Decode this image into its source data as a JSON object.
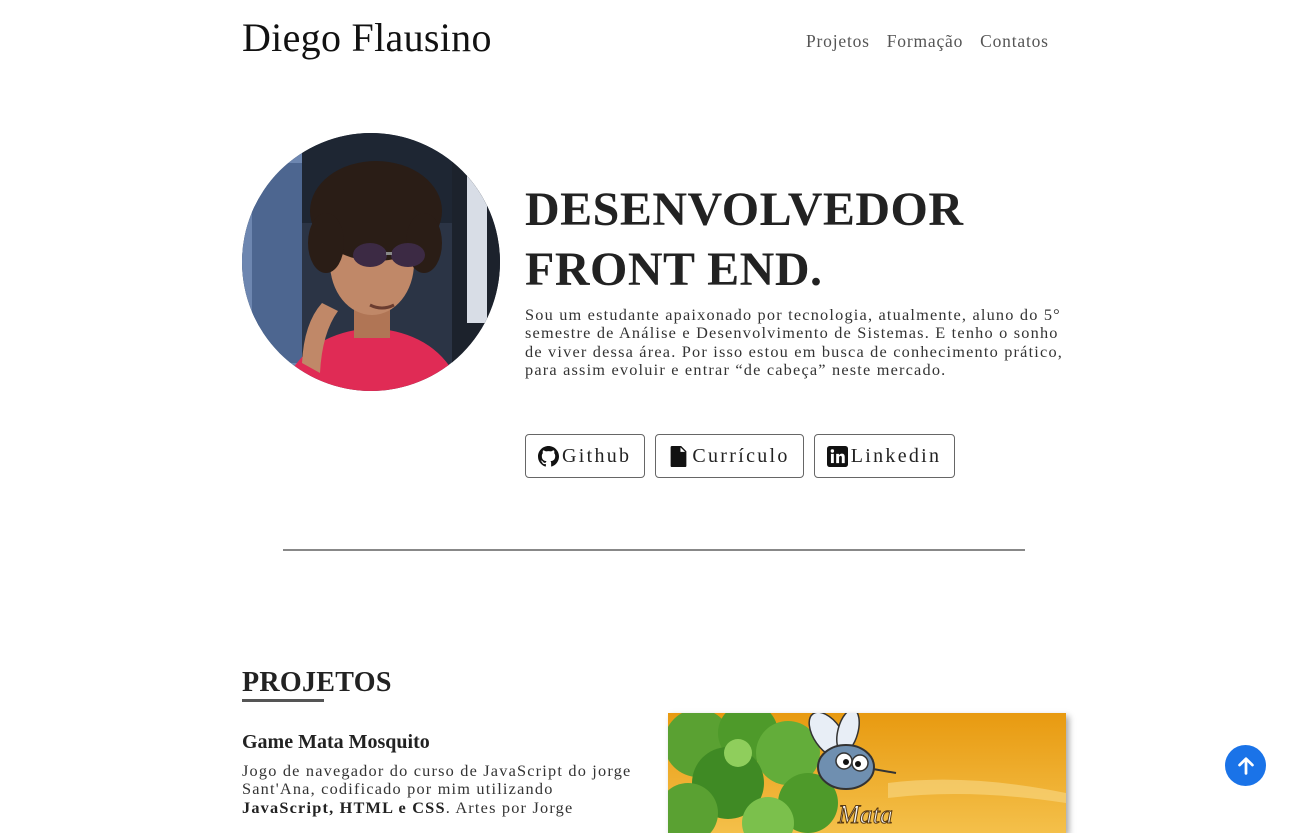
{
  "header": {
    "logo": "Diego Flausino",
    "nav": [
      {
        "label": "Projetos"
      },
      {
        "label": "Formação"
      },
      {
        "label": "Contatos"
      }
    ]
  },
  "hero": {
    "title_line1": "DESENVOLVEDOR",
    "title_line2": "FRONT END.",
    "description": "Sou um estudante apaixonado por tecnologia, atualmente, aluno do 5° semestre de Análise e Desenvolvimento de Sistemas. E tenho o sonho de viver dessa área. Por isso estou em busca de conhecimento prático, para assim evoluir e entrar “de cabeça” neste mercado.",
    "buttons": [
      {
        "label": "Github",
        "icon": "github-icon"
      },
      {
        "label": "Currículo",
        "icon": "file-icon"
      },
      {
        "label": "Linkedin",
        "icon": "linkedin-icon"
      }
    ]
  },
  "projects": {
    "section_title": "PROJETOS",
    "items": [
      {
        "title": "Game Mata Mosquito",
        "desc_prefix": "Jogo de navegador do curso de JavaScript do jorge Sant'Ana, codificado por mim utilizando ",
        "desc_bold": "JavaScript, HTML e CSS",
        "desc_suffix": ". Artes por Jorge",
        "image_text": "Mata"
      }
    ]
  },
  "scroll_top": {
    "icon": "arrow-up-icon"
  },
  "colors": {
    "accent": "#1a73e8",
    "text": "#222222",
    "nav": "#555555"
  }
}
